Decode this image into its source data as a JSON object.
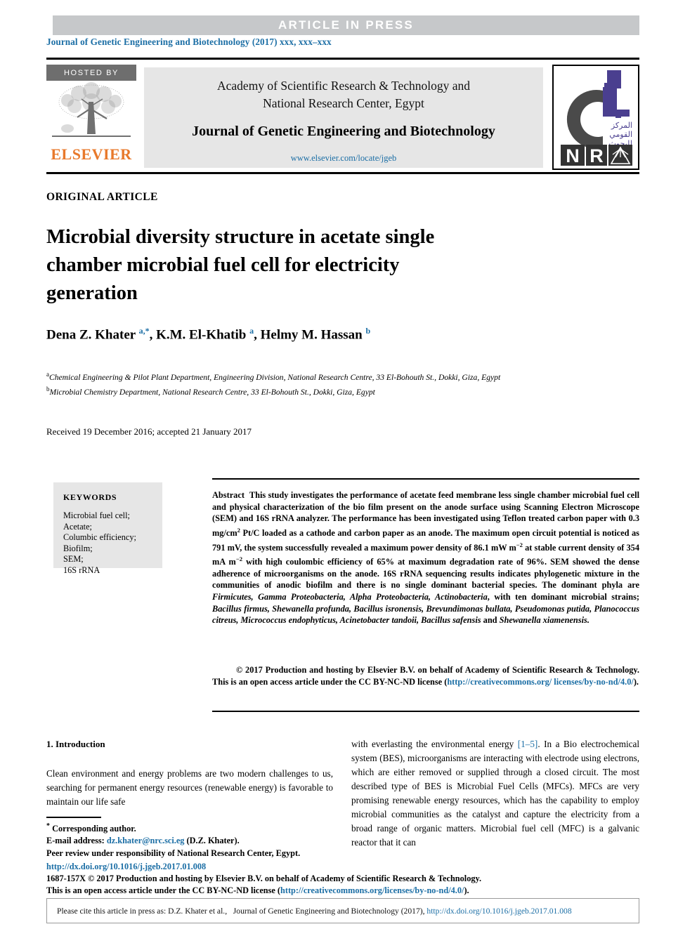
{
  "banner": {
    "article_in_press": "ARTICLE  IN  PRESS",
    "journal_citation": "Journal of Genetic Engineering and Biotechnology (2017) xxx, xxx–xxx"
  },
  "masthead": {
    "hosted_by": "HOSTED BY",
    "publisher_wordmark": "ELSEVIER",
    "academy_line1": "Academy of Scientific Research & Technology and",
    "academy_line2": "National Research Center, Egypt",
    "journal_name": "Journal of Genetic Engineering and Biotechnology",
    "journal_url": "www.elsevier.com/locate/jgeb",
    "nrc_arabic_line1": "المركز",
    "nrc_arabic_line2": "القومي",
    "nrc_arabic_line3": "للبحوث",
    "nrc_acronym": "NRC"
  },
  "article": {
    "type_label": "ORIGINAL ARTICLE",
    "title": "Microbial diversity structure in acetate single chamber microbial fuel cell for electricity generation",
    "authors_html": "Dena Z. Khater <sup>a,*</sup>, K.M. El-Khatib <sup>a</sup>, Helmy M. Hassan <sup>b</sup>",
    "affiliation_a": "Chemical Engineering & Pilot Plant Department, Engineering Division, National Research Centre, 33 El-Bohouth St., Dokki, Giza, Egypt",
    "affiliation_b": "Microbial Chemistry Department, National Research Centre, 33 El-Bohouth St., Dokki, Giza, Egypt",
    "received": "Received 19 December 2016; accepted 21 January 2017"
  },
  "keywords": {
    "heading": "KEYWORDS",
    "items": [
      "Microbial fuel cell;",
      "Acetate;",
      "Columbic efficiency;",
      "Biofilm;",
      "SEM;",
      "16S rRNA"
    ]
  },
  "abstract": {
    "label": "Abstract",
    "body_html": "This study investigates the performance of acetate feed membrane less single chamber microbial fuel cell and physical characterization of the bio film present on the anode surface using Scanning Electron Microscope (SEM) and 16S rRNA analyzer. The performance has been investigated using Teflon treated carbon paper with 0.3 mg/cm<sup>2</sup> Pt/C loaded as a cathode and carbon paper as an anode. The maximum open circuit potential is noticed as 791 mV, the system successfully revealed a maximum power density of 86.1 mW m<sup>&#8722;2</sup> at stable current density of 354 mA m<sup>&#8722;2</sup> with high coulombic efficiency of 65% at maximum degradation rate of 96%. SEM showed the dense adherence of microorganisms on the anode. 16S rRNA sequencing results indicates phylogenetic mixture in the communities of anodic biofilm and there is no single dominant bacterial species. The dominant phyla are <i>Firmicutes, Gamma Proteobacteria, Alpha Proteobacteria, Actinobacteria</i>, with ten dominant microbial strains; <i>Bacillus firmus, Shewanella profunda, Bacillus isronensis, Brevundimonas bullata, Pseudomonas putida, Planococcus citreus, Micrococcus endophyticus, Acinetobacter tandoii, Bacillus safensis</i> and <i>Shewanella xiamenensis.</i>",
    "copyright_html": "&copy; 2017 Production and hosting by Elsevier B.V. on behalf of Academy of Scientific Research &amp; Technology. This is an open access article under the CC BY-NC-ND license (<span class=\"lnk\">http://creativecommons.org/ licenses/by-no-nd/4.0/</span>)."
  },
  "body": {
    "section_heading": "1. Introduction",
    "left_column": "Clean environment and energy problems are two modern challenges to us, searching for permanent energy resources (renewable energy) is favorable to maintain our life safe",
    "right_column_html": "with everlasting the environmental energy <span class=\"lnk\">[1–5]</span>. In a Bio electrochemical system (BES), microorganisms are interacting with electrode using electrons, which are either removed or supplied through a closed circuit. The most described type of BES is Microbial Fuel Cells (MFCs). MFCs are very promising renewable energy resources, which has the capability to employ microbial communities as the catalyst and capture the electricity from a broad range of organic matters. Microbial fuel cell (MFC) is a galvanic reactor that it can"
  },
  "footnotes": {
    "corresponding_html": "<sup>*</sup> Corresponding author.",
    "email_html": "E-mail address: <span class=\"lnk\">dz.khater@nrc.sci.eg</span> (D.Z. Khater).",
    "peer_review": "Peer review under responsibility of National Research Center, Egypt.",
    "doi_html": "<span class=\"lnk\">http://dx.doi.org/10.1016/j.jgeb.2017.01.008</span>",
    "issn_line": "1687-157X © 2017 Production and hosting by Elsevier B.V. on behalf of Academy of Scientific Research & Technology.",
    "license_html": "This is an open access article under the CC BY-NC-ND license (<span class=\"lnk\">http://creativecommons.org/licenses/by-no-nd/4.0/</span>)."
  },
  "cite_box": {
    "text_html": "Please cite this article in press as: D.Z. Khater et al.,&nbsp;&nbsp; Journal of Genetic Engineering and Biotechnology (2017), <span class=\"lnk\">http://dx.doi.org/10.1016/j.jgeb.2017.01.008</span>"
  },
  "colors": {
    "banner_gray": "#c6c8ca",
    "masthead_gray": "#e6e6e6",
    "hosted_gray": "#6e6e6e",
    "link_blue": "#1b6ea5",
    "elsevier_orange": "#e8792b",
    "nrc_purple": "#4a3f8f"
  }
}
